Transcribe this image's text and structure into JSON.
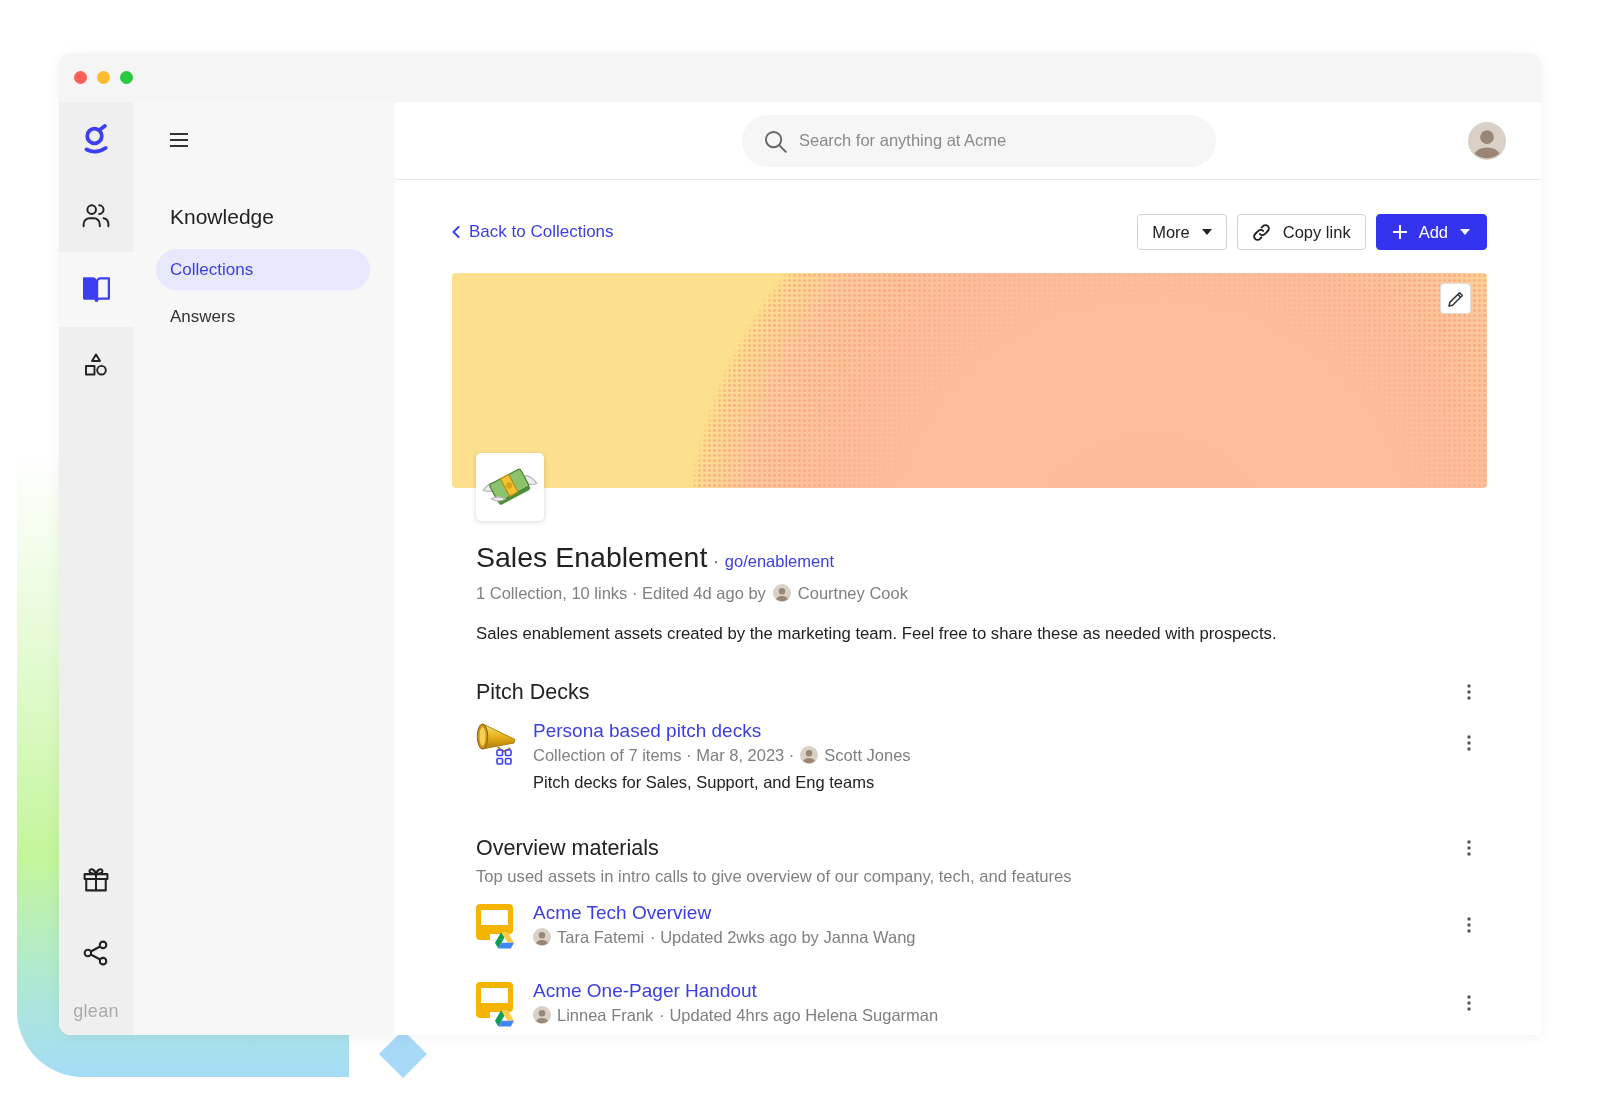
{
  "rail": {
    "items": [
      {
        "selected": false
      },
      {
        "selected": true
      },
      {
        "selected": false
      }
    ],
    "wordmark": "glean"
  },
  "nav": {
    "title": "Knowledge",
    "items": [
      {
        "label": "Collections",
        "selected": true
      },
      {
        "label": "Answers",
        "selected": false
      }
    ]
  },
  "search": {
    "placeholder": "Search for anything at Acme"
  },
  "toolbar": {
    "back_link": "Back to Collections",
    "buttons": [
      {
        "label": "More",
        "kind": "menu"
      },
      {
        "label": "Copy link",
        "kind": "copy"
      },
      {
        "label": "Add",
        "kind": "primary"
      }
    ]
  },
  "collection": {
    "title": "Sales Enablement",
    "separator": "·",
    "golink": "go/enablement",
    "meta": "1 Collection, 10 links · Edited 4d ago by",
    "author": "Courtney Cook",
    "description": "Sales enablement assets created by the marketing team. Feel free to share these as needed with prospects."
  },
  "sections": [
    {
      "title": "Pitch Decks",
      "items": [
        {
          "kind": "collection",
          "title": "Persona based pitch decks",
          "meta_before": "Collection of 7 items · Mar 8, 2023 ·",
          "person": "Scott Jones",
          "description": "Pitch decks for Sales, Support, and Eng teams"
        }
      ]
    },
    {
      "title": "Overview materials",
      "description": "Top used assets in intro calls to give overview of our company, tech, and features",
      "items": [
        {
          "kind": "slides",
          "title": "Acme Tech Overview",
          "person": "Tara Fatemi",
          "meta_after": "· Updated 2wks ago by Janna Wang"
        },
        {
          "kind": "slides",
          "title": "Acme One-Pager Handout",
          "person": "Linnea Frank",
          "meta_after": "· Updated 4hrs ago Helena Sugarman"
        }
      ]
    }
  ]
}
